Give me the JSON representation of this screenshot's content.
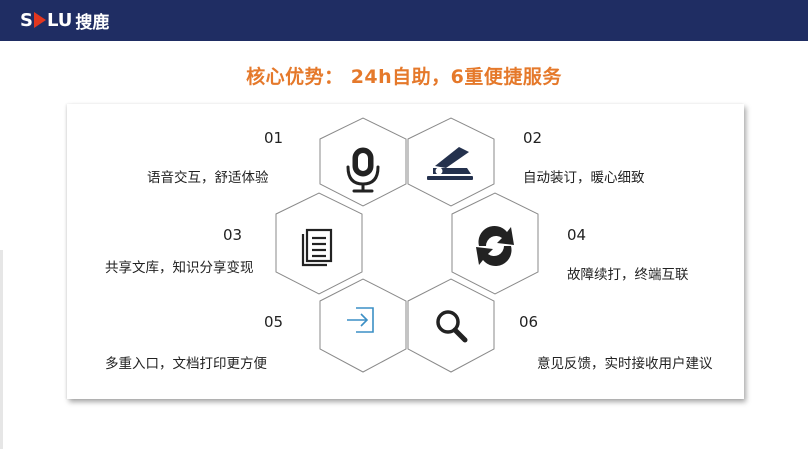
{
  "header": {
    "logo_text_left": "S",
    "logo_text_right": "LU",
    "logo_text_cn": "搜鹿",
    "bar_color": "#1f2d63",
    "accent_red": "#e2371f"
  },
  "slide": {
    "title": "核心优势： 24h自助，6重便捷服务",
    "title_color": "#e5792b"
  },
  "features": [
    {
      "num": "01",
      "text": "语音交互，舒适体验",
      "icon": "microphone-icon"
    },
    {
      "num": "02",
      "text": "自动装订，暖心细致",
      "icon": "stapler-icon"
    },
    {
      "num": "03",
      "text": "共享文库，知识分享变现",
      "icon": "documents-icon"
    },
    {
      "num": "04",
      "text": "故障续打，终端互联",
      "icon": "refresh-icon"
    },
    {
      "num": "05",
      "text": "多重入口，文档打印更方便",
      "icon": "login-icon"
    },
    {
      "num": "06",
      "text": "意见反馈，实时接收用户建议",
      "icon": "search-icon"
    }
  ]
}
